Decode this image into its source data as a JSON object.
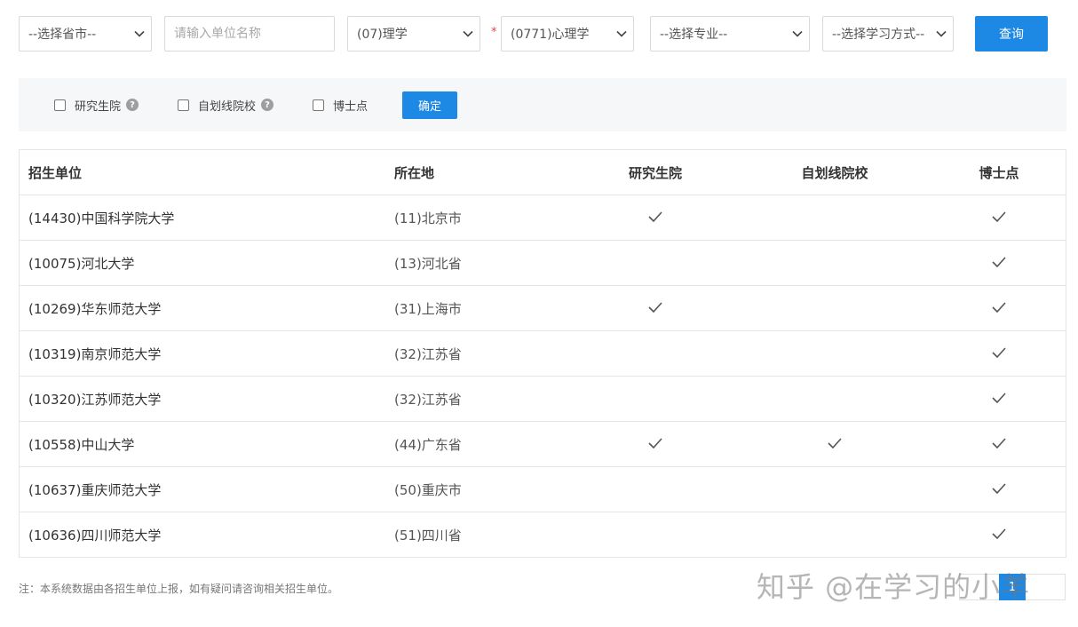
{
  "filters": {
    "province": {
      "value": "--选择省市--"
    },
    "unit_name": {
      "placeholder": "请输入单位名称"
    },
    "discipline": {
      "value": "(07)理学"
    },
    "required_mark": "*",
    "subject": {
      "value": "(0771)心理学"
    },
    "major": {
      "value": "--选择专业--"
    },
    "study_mode": {
      "value": "--选择学习方式--"
    },
    "query_label": "查询"
  },
  "options": {
    "graduate_school": "研究生院",
    "self_line": "自划线院校",
    "phd_point": "博士点",
    "help_glyph": "?",
    "confirm_label": "确定"
  },
  "table": {
    "headers": {
      "unit": "招生单位",
      "location": "所在地",
      "graduate_school": "研究生院",
      "self_line": "自划线院校",
      "phd_point": "博士点"
    },
    "rows": [
      {
        "unit": "(14430)中国科学院大学",
        "location": "(11)北京市",
        "graduate_school": true,
        "self_line": false,
        "phd_point": true
      },
      {
        "unit": "(10075)河北大学",
        "location": "(13)河北省",
        "graduate_school": false,
        "self_line": false,
        "phd_point": true
      },
      {
        "unit": "(10269)华东师范大学",
        "location": "(31)上海市",
        "graduate_school": true,
        "self_line": false,
        "phd_point": true
      },
      {
        "unit": "(10319)南京师范大学",
        "location": "(32)江苏省",
        "graduate_school": false,
        "self_line": false,
        "phd_point": true
      },
      {
        "unit": "(10320)江苏师范大学",
        "location": "(32)江苏省",
        "graduate_school": false,
        "self_line": false,
        "phd_point": true
      },
      {
        "unit": "(10558)中山大学",
        "location": "(44)广东省",
        "graduate_school": true,
        "self_line": true,
        "phd_point": true
      },
      {
        "unit": "(10637)重庆师范大学",
        "location": "(50)重庆市",
        "graduate_school": false,
        "self_line": false,
        "phd_point": true
      },
      {
        "unit": "(10636)四川师范大学",
        "location": "(51)四川省",
        "graduate_school": false,
        "self_line": false,
        "phd_point": true
      }
    ]
  },
  "footer": {
    "note": "注：本系统数据由各招生单位上报，如有疑问请咨询相关招生单位。",
    "watermark": "知乎 @在学习的小羊",
    "page_number": "1"
  },
  "colors": {
    "primary": "#1e88e5",
    "required": "#e64545",
    "options_bg": "#f6f7f9",
    "border": "#e5e5e5"
  },
  "icons": {
    "dropdown": "chevron-down-icon",
    "help": "help-circle-icon",
    "checked": "check-icon"
  }
}
